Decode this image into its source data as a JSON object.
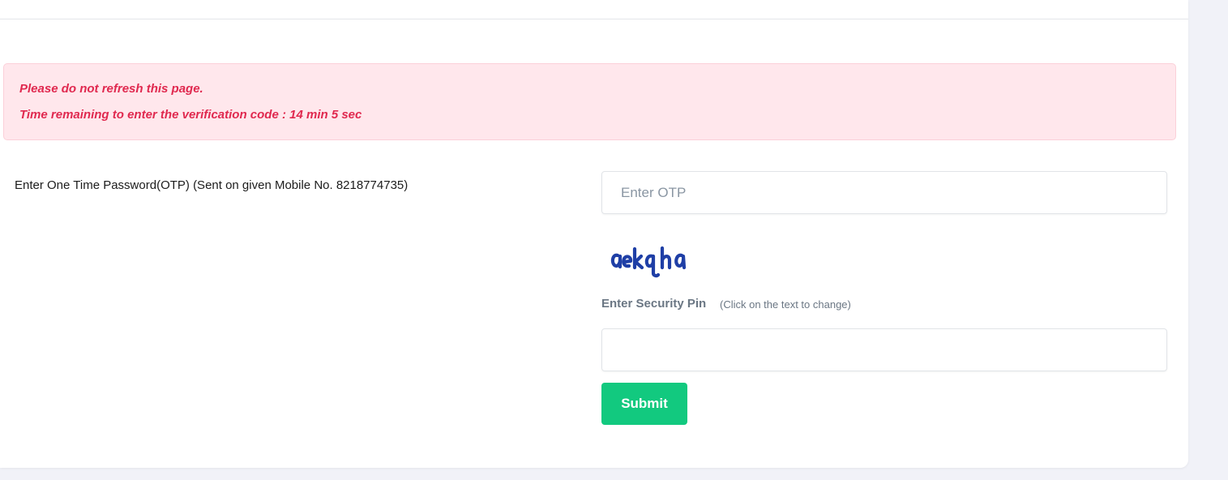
{
  "alert": {
    "line1": "Please do not refresh this page.",
    "line2": "Time remaining to enter the verification code : 14 min 5 sec",
    "text_color": "#e0294f",
    "background_color": "#ffe7ec"
  },
  "otp": {
    "label": "Enter One Time Password(OTP) (Sent on given Mobile No. 8218774735)",
    "placeholder": "Enter OTP",
    "value": ""
  },
  "captcha": {
    "text": "aekqha",
    "color": "#1f3fa6"
  },
  "security_pin": {
    "label": "Enter Security Pin",
    "hint": "(Click on the text to change)",
    "value": ""
  },
  "submit": {
    "label": "Submit",
    "color": "#12c97f"
  }
}
